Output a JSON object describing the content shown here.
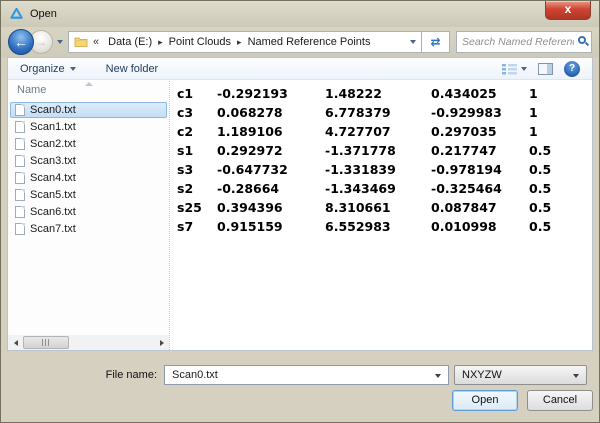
{
  "window": {
    "title": "Open",
    "close_glyph": "x"
  },
  "navigation": {
    "back_glyph": "←",
    "forward_glyph": "→",
    "breadcrumb": {
      "overflow": "«",
      "separator": "▸",
      "items": [
        "Data (E:)",
        "Point Clouds",
        "Named Reference Points"
      ]
    },
    "refresh_glyph": "⇄",
    "search_placeholder": "Search Named Reference Points"
  },
  "toolbar": {
    "organize": "Organize",
    "new_folder": "New folder",
    "help_glyph": "?"
  },
  "file_list": {
    "header": "Name",
    "selected_index": 0,
    "files": [
      "Scan0.txt",
      "Scan1.txt",
      "Scan2.txt",
      "Scan3.txt",
      "Scan4.txt",
      "Scan5.txt",
      "Scan6.txt",
      "Scan7.txt"
    ]
  },
  "preview": {
    "rows": [
      {
        "label": "c1",
        "values": [
          "-0.292193",
          "1.48222",
          "0.434025",
          "1"
        ]
      },
      {
        "label": "c3",
        "values": [
          "0.068278",
          "6.778379",
          "-0.929983",
          "1"
        ]
      },
      {
        "label": "c2",
        "values": [
          "1.189106",
          "4.727707",
          "0.297035",
          "1"
        ]
      },
      {
        "label": "s1",
        "values": [
          "0.292972",
          "-1.371778",
          "0.217747",
          "0.5"
        ]
      },
      {
        "label": "s3",
        "values": [
          "-0.647732",
          "-1.331839",
          "-0.978194",
          "0.5"
        ]
      },
      {
        "label": "s2",
        "values": [
          "-0.28664",
          "-1.343469",
          "-0.325464",
          "0.5"
        ]
      },
      {
        "label": "s25",
        "values": [
          "0.394396",
          "8.310661",
          "0.087847",
          "0.5"
        ]
      },
      {
        "label": "s7",
        "values": [
          "0.915159",
          "6.552983",
          "0.010998",
          "0.5"
        ]
      }
    ]
  },
  "footer": {
    "file_name_label": "File name:",
    "file_name_value": "Scan0.txt",
    "file_type_value": "NXYZW",
    "open": "Open",
    "cancel": "Cancel"
  },
  "colors": {
    "chrome_tan": "#d5d0c0",
    "selection_fill": "#cde2f6",
    "selection_border": "#8db8e3",
    "close_red": "#cf4433",
    "accent_blue": "#2d72c0"
  }
}
